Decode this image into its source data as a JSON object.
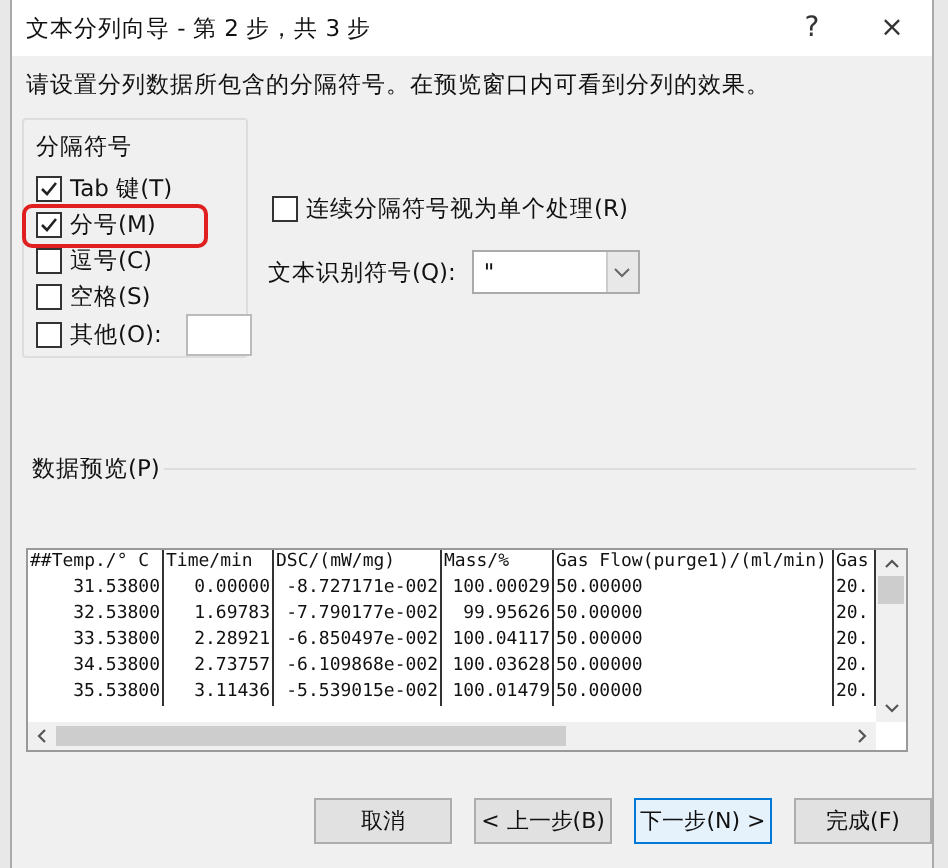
{
  "window": {
    "title": "文本分列向导 - 第 2 步，共 3 步",
    "help": "?",
    "close": "×"
  },
  "instruction": "请设置分列数据所包含的分隔符号。在预览窗口内可看到分列的效果。",
  "delimiters": {
    "title": "分隔符号",
    "options": [
      {
        "label": "Tab 键(T)",
        "checked": true,
        "highlighted": false
      },
      {
        "label": "分号(M)",
        "checked": true,
        "highlighted": true
      },
      {
        "label": "逗号(C)",
        "checked": false,
        "highlighted": false
      },
      {
        "label": "空格(S)",
        "checked": false,
        "highlighted": false
      },
      {
        "label": "其他(O):",
        "checked": false,
        "highlighted": false
      }
    ]
  },
  "consecutive": {
    "label": "连续分隔符号视为单个处理(R)",
    "checked": false
  },
  "qualifier": {
    "label": "文本识别符号(Q):",
    "value": "\""
  },
  "preview": {
    "title": "数据预览(P)",
    "columns": [
      "##Temp./° C",
      "Time/min",
      "DSC/(mW/mg)",
      "Mass/%",
      "Gas Flow(purge1)/(ml/min)",
      "Gas"
    ],
    "rows": [
      [
        "31.53800",
        "0.00000",
        "-8.727171e-002",
        "100.00029",
        "50.00000",
        "20."
      ],
      [
        "32.53800",
        "1.69783",
        "-7.790177e-002",
        "99.95626",
        "50.00000",
        "20."
      ],
      [
        "33.53800",
        "2.28921",
        "-6.850497e-002",
        "100.04117",
        "50.00000",
        "20."
      ],
      [
        "34.53800",
        "2.73757",
        "-6.109868e-002",
        "100.03628",
        "50.00000",
        "20."
      ],
      [
        "35.53800",
        "3.11436",
        "-5.539015e-002",
        "100.01479",
        "50.00000",
        "20."
      ]
    ]
  },
  "buttons": [
    {
      "label": "取消",
      "kind": "normal"
    },
    {
      "label": "< 上一步(B)",
      "kind": "normal"
    },
    {
      "label": "下一步(N) >",
      "kind": "default"
    },
    {
      "label": "完成(F)",
      "kind": "normal"
    }
  ]
}
